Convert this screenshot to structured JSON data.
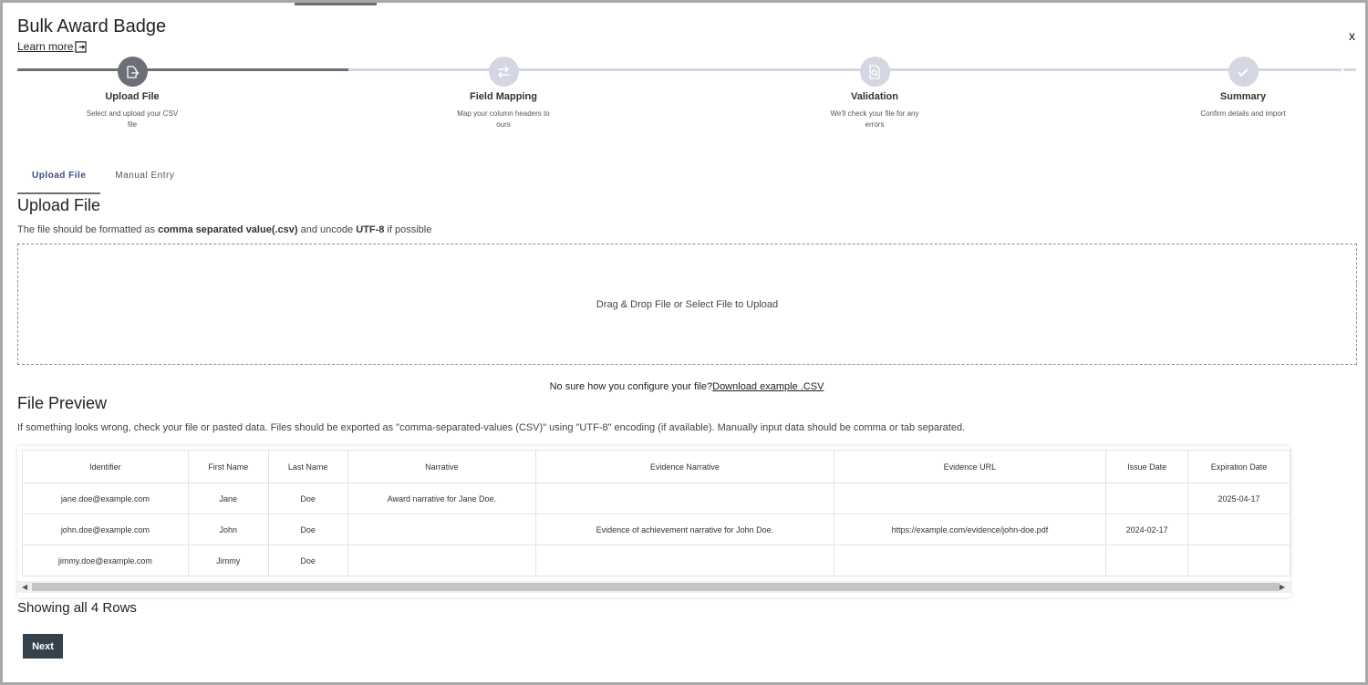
{
  "modal": {
    "title": "Bulk Award Badge",
    "learn_more": "Learn more",
    "close_label": "x"
  },
  "steps": [
    {
      "title": "Upload File",
      "desc": "Select and upload your CSV file",
      "state": "active",
      "icon": "upload-file-icon"
    },
    {
      "title": "Field Mapping",
      "desc": "Map your column headers to ours",
      "state": "todo",
      "icon": "swap-arrows-icon"
    },
    {
      "title": "Validation",
      "desc": "We'll check your file for any errors",
      "state": "todo",
      "icon": "file-search-icon"
    },
    {
      "title": "Summary",
      "desc": "Confirm details and import",
      "state": "todo",
      "icon": "checkmark-icon"
    }
  ],
  "tabs": [
    {
      "label": "Upload File",
      "active": true
    },
    {
      "label": "Manual Entry",
      "active": false
    }
  ],
  "upload": {
    "heading": "Upload File",
    "instr_prefix": "The file should be formatted as ",
    "instr_bold1": "comma separated value(.csv)",
    "instr_mid": " and uncode ",
    "instr_bold2": "UTF-8",
    "instr_suffix": " if possible",
    "dropzone_text": "Drag & Drop File or Select File to Upload",
    "help_text": "No sure how you configure your file?",
    "help_link": "Download example .CSV"
  },
  "preview": {
    "heading": "File Preview",
    "desc": "If something looks wrong, check your file or pasted data. Files should be exported as \"comma-separated-values (CSV)\" using \"UTF-8\" encoding (if available). Manually input data should be comma or tab separated.",
    "columns": [
      "Identifier",
      "First Name",
      "Last Name",
      "Narrative",
      "Evidence Narrative",
      "Evidence URL",
      "Issue Date",
      "Expiration Date"
    ],
    "rows": [
      [
        "jane.doe@example.com",
        "Jane",
        "Doe",
        "Award narrative for Jane Doe.",
        "",
        "",
        "",
        "2025-04-17"
      ],
      [
        "john.doe@example.com",
        "John",
        "Doe",
        "",
        "Evidence of achievement narrative for John Doe.",
        "https://example.com/evidence/john-doe.pdf",
        "2024-02-17",
        ""
      ],
      [
        "jimmy.doe@example.com",
        "Jimmy",
        "Doe",
        "",
        "",
        "",
        "",
        ""
      ]
    ],
    "rows_count": "Showing all 4 Rows"
  },
  "actions": {
    "next_label": "Next"
  },
  "colors": {
    "active_step": "#6d6f78",
    "todo_step": "#d4d6e3",
    "next_button": "#36424b",
    "active_tab_text": "#3c4a8c"
  }
}
